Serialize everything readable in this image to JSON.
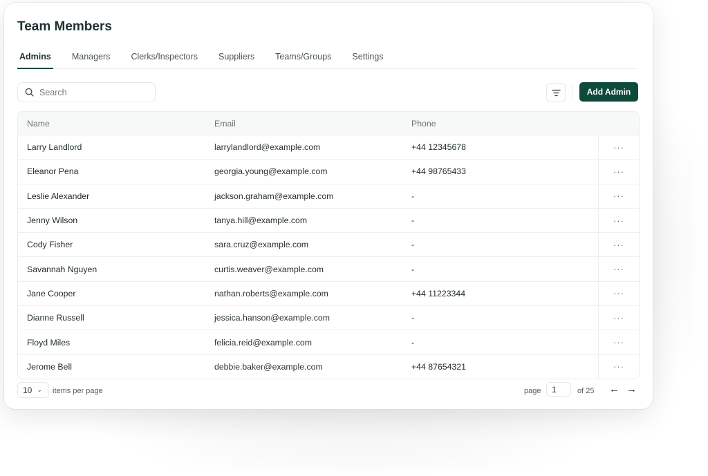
{
  "header": {
    "title": "Team Members"
  },
  "tabs": [
    {
      "label": "Admins",
      "active": true
    },
    {
      "label": "Managers",
      "active": false
    },
    {
      "label": "Clerks/Inspectors",
      "active": false
    },
    {
      "label": "Suppliers",
      "active": false
    },
    {
      "label": "Teams/Groups",
      "active": false
    },
    {
      "label": "Settings",
      "active": false
    }
  ],
  "toolbar": {
    "search_placeholder": "Search",
    "search_value": "",
    "filter_icon": "filter-icon",
    "add_label": "Add Admin",
    "accent_color": "#0e4a3a"
  },
  "table": {
    "columns": [
      "Name",
      "Email",
      "Phone"
    ],
    "action_glyph": "···",
    "rows": [
      {
        "name": "Larry Landlord",
        "email": "larrylandlord@example.com",
        "phone": "+44 12345678"
      },
      {
        "name": "Eleanor Pena",
        "email": "georgia.young@example.com",
        "phone": "+44 98765433"
      },
      {
        "name": "Leslie Alexander",
        "email": "jackson.graham@example.com",
        "phone": "-"
      },
      {
        "name": "Jenny Wilson",
        "email": "tanya.hill@example.com",
        "phone": "-"
      },
      {
        "name": "Cody Fisher",
        "email": "sara.cruz@example.com",
        "phone": "-"
      },
      {
        "name": "Savannah Nguyen",
        "email": "curtis.weaver@example.com",
        "phone": "-"
      },
      {
        "name": "Jane Cooper",
        "email": "nathan.roberts@example.com",
        "phone": "+44 11223344"
      },
      {
        "name": "Dianne Russell",
        "email": "jessica.hanson@example.com",
        "phone": "-"
      },
      {
        "name": "Floyd Miles",
        "email": "felicia.reid@example.com",
        "phone": "-"
      },
      {
        "name": "Jerome Bell",
        "email": "debbie.baker@example.com",
        "phone": "+44 87654321"
      }
    ]
  },
  "pagination": {
    "per_page_value": "10",
    "per_page_label": "items per page",
    "page_label": "page",
    "current_page": "1",
    "of_label": "of 25",
    "prev_glyph": "←",
    "next_glyph": "→"
  }
}
